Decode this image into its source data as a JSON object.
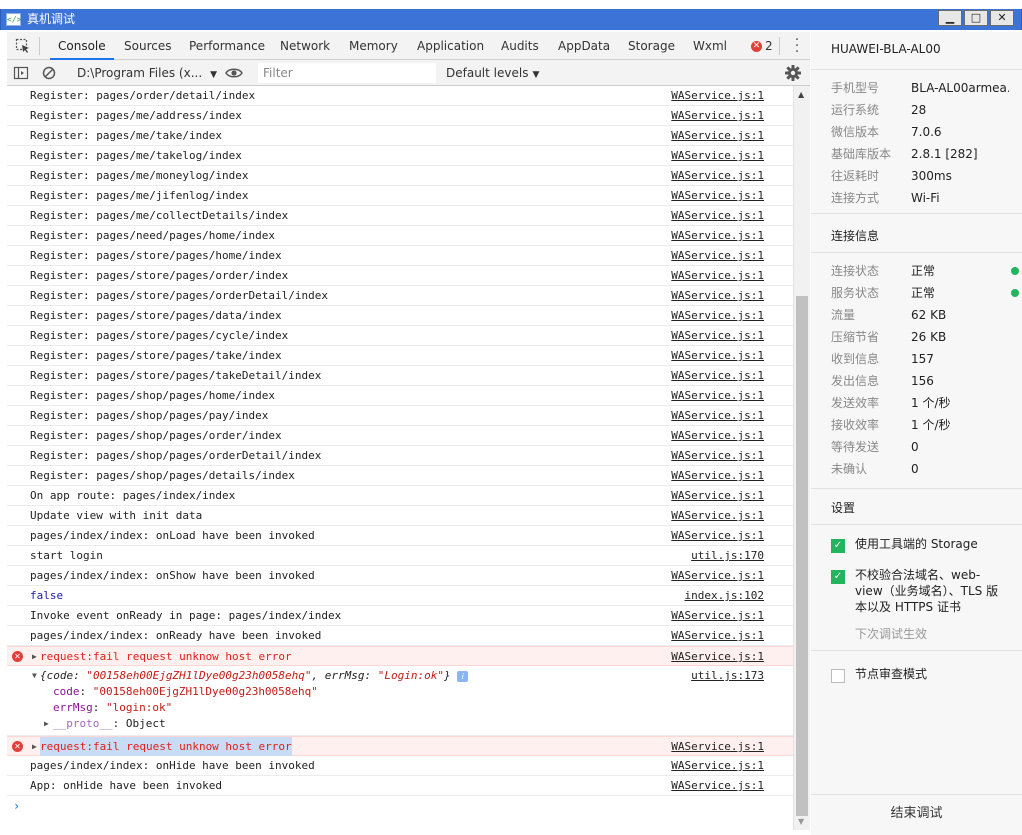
{
  "window": {
    "title": "真机调试",
    "icon_text": "</>"
  },
  "tabs": [
    {
      "label": "Console",
      "active": true
    },
    {
      "label": "Sources"
    },
    {
      "label": "Performance"
    },
    {
      "label": "Network"
    },
    {
      "label": "Memory"
    },
    {
      "label": "Application"
    },
    {
      "label": "Audits"
    },
    {
      "label": "AppData"
    },
    {
      "label": "Storage"
    },
    {
      "label": "Wxml"
    }
  ],
  "error_count": "2",
  "toolbar": {
    "context": "D:\\Program Files (x...",
    "filter_placeholder": "Filter",
    "levels": "Default levels"
  },
  "logs": [
    {
      "msg": "Register: pages/order/detail/index",
      "src": "WAService.js:1"
    },
    {
      "msg": "Register: pages/me/address/index",
      "src": "WAService.js:1"
    },
    {
      "msg": "Register: pages/me/take/index",
      "src": "WAService.js:1"
    },
    {
      "msg": "Register: pages/me/takelog/index",
      "src": "WAService.js:1"
    },
    {
      "msg": "Register: pages/me/moneylog/index",
      "src": "WAService.js:1"
    },
    {
      "msg": "Register: pages/me/jifenlog/index",
      "src": "WAService.js:1"
    },
    {
      "msg": "Register: pages/me/collectDetails/index",
      "src": "WAService.js:1"
    },
    {
      "msg": "Register: pages/need/pages/home/index",
      "src": "WAService.js:1"
    },
    {
      "msg": "Register: pages/store/pages/home/index",
      "src": "WAService.js:1"
    },
    {
      "msg": "Register: pages/store/pages/order/index",
      "src": "WAService.js:1"
    },
    {
      "msg": "Register: pages/store/pages/orderDetail/index",
      "src": "WAService.js:1"
    },
    {
      "msg": "Register: pages/store/pages/data/index",
      "src": "WAService.js:1"
    },
    {
      "msg": "Register: pages/store/pages/cycle/index",
      "src": "WAService.js:1"
    },
    {
      "msg": "Register: pages/store/pages/take/index",
      "src": "WAService.js:1"
    },
    {
      "msg": "Register: pages/store/pages/takeDetail/index",
      "src": "WAService.js:1"
    },
    {
      "msg": "Register: pages/shop/pages/home/index",
      "src": "WAService.js:1"
    },
    {
      "msg": "Register: pages/shop/pages/pay/index",
      "src": "WAService.js:1"
    },
    {
      "msg": "Register: pages/shop/pages/order/index",
      "src": "WAService.js:1"
    },
    {
      "msg": "Register: pages/shop/pages/orderDetail/index",
      "src": "WAService.js:1"
    },
    {
      "msg": "Register: pages/shop/pages/details/index",
      "src": "WAService.js:1"
    },
    {
      "msg": "On app route: pages/index/index",
      "src": "WAService.js:1"
    },
    {
      "msg": "Update view with init data",
      "src": "WAService.js:1"
    },
    {
      "msg": "pages/index/index: onLoad have been invoked",
      "src": "WAService.js:1"
    },
    {
      "msg": "start login",
      "src": "util.js:170"
    },
    {
      "msg": "pages/index/index: onShow have been invoked",
      "src": "WAService.js:1"
    },
    {
      "msg": "false",
      "src": "index.js:102"
    },
    {
      "msg": "Invoke event onReady in page: pages/index/index",
      "src": "WAService.js:1"
    },
    {
      "msg": "pages/index/index: onReady have been invoked",
      "src": "WAService.js:1"
    }
  ],
  "error1": {
    "msg": "request:fail request unknow host error",
    "src": "WAService.js:1"
  },
  "object_log": {
    "summary_prefix": "{code: ",
    "summary_code": "\"00158eh00EjgZH1lDye00g23h0058ehq\"",
    "summary_mid": ", errMsg: ",
    "summary_errmsg": "\"Login:ok\"",
    "summary_suffix": "}",
    "code_key": "code",
    "code_val": "\"00158eh00EjgZH1lDye00g23h0058ehq\"",
    "errmsg_key": "errMsg",
    "errmsg_val": "\"login:ok\"",
    "proto_key": "__proto__",
    "proto_val": "Object",
    "src": "util.js:173"
  },
  "error2": {
    "msg": "request:fail request unknow host error",
    "src": "WAService.js:1"
  },
  "tail_logs": [
    {
      "msg": "pages/index/index: onHide have been invoked",
      "src": "WAService.js:1"
    },
    {
      "msg": "App: onHide have been invoked",
      "src": "WAService.js:1"
    }
  ],
  "device": {
    "name": "HUAWEI-BLA-AL00",
    "info": [
      {
        "k": "手机型号",
        "v": "BLA-AL00armea..."
      },
      {
        "k": "运行系统",
        "v": "28"
      },
      {
        "k": "微信版本",
        "v": "7.0.6"
      },
      {
        "k": "基础库版本",
        "v": "2.8.1 [282]"
      },
      {
        "k": "往返耗时",
        "v": "300ms"
      },
      {
        "k": "连接方式",
        "v": "Wi-Fi"
      }
    ]
  },
  "connection": {
    "title": "连接信息",
    "items": [
      {
        "k": "连接状态",
        "v": "正常"
      },
      {
        "k": "服务状态",
        "v": "正常"
      },
      {
        "k": "流量",
        "v": "62 KB"
      },
      {
        "k": "压缩节省",
        "v": "26 KB"
      },
      {
        "k": "收到信息",
        "v": "157"
      },
      {
        "k": "发出信息",
        "v": "156"
      },
      {
        "k": "发送效率",
        "v": "1 个/秒"
      },
      {
        "k": "接收效率",
        "v": "1 个/秒"
      },
      {
        "k": "等待发送",
        "v": "0"
      },
      {
        "k": "未确认",
        "v": "0"
      }
    ]
  },
  "settings": {
    "title": "设置",
    "use_storage": "使用工具端的 Storage",
    "skip_check_1": "不校验合法域名、web-",
    "skip_check_2": "view（业务域名）、TLS 版",
    "skip_check_3": "本以及 HTTPS 证书",
    "skip_check_note": "下次调试生效",
    "node_audit": "节点审查模式"
  },
  "end_button": "结束调试",
  "colors": {
    "titlebar": "#3b73d6",
    "accent_green": "#21b55e",
    "error_red": "#e0201a"
  }
}
